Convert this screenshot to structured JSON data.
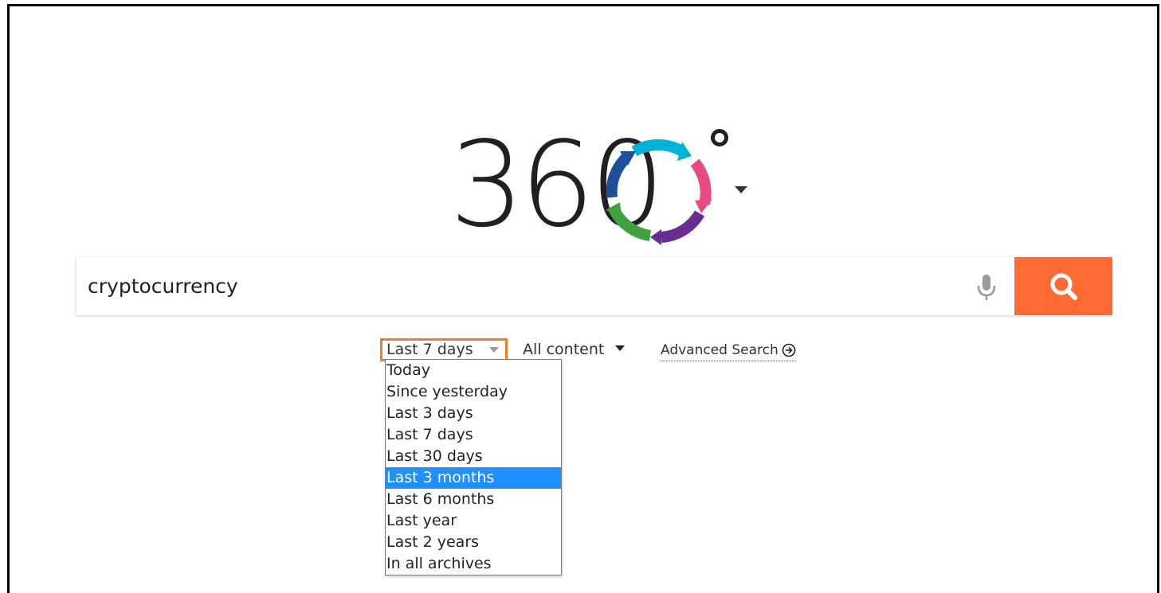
{
  "logo": {
    "text": "360",
    "ring_colors": [
      "#00b2d6",
      "#e84b84",
      "#6a2c91",
      "#3fa142",
      "#1d4f9b"
    ],
    "icon": "360-logo-icon"
  },
  "search": {
    "value": "cryptocurrency",
    "placeholder": "",
    "mic_icon": "microphone-icon",
    "button_icon": "search-icon",
    "button_color": "#ff6b35"
  },
  "filters": {
    "date": {
      "selected": "Last 7 days",
      "highlight_color": "#ef7d2c"
    },
    "content": {
      "selected": "All content"
    },
    "advanced": {
      "label": "Advanced Search",
      "icon": "arrow-circle-right-icon"
    }
  },
  "dropdown": {
    "items": [
      "Today",
      "Since yesterday",
      "Last 3 days",
      "Last 7 days",
      "Last 30 days",
      "Last 3 months",
      "Last 6 months",
      "Last year",
      "Last 2 years",
      "In all archives"
    ],
    "hovered_index": 5,
    "hover_color": "#1e90ff"
  }
}
